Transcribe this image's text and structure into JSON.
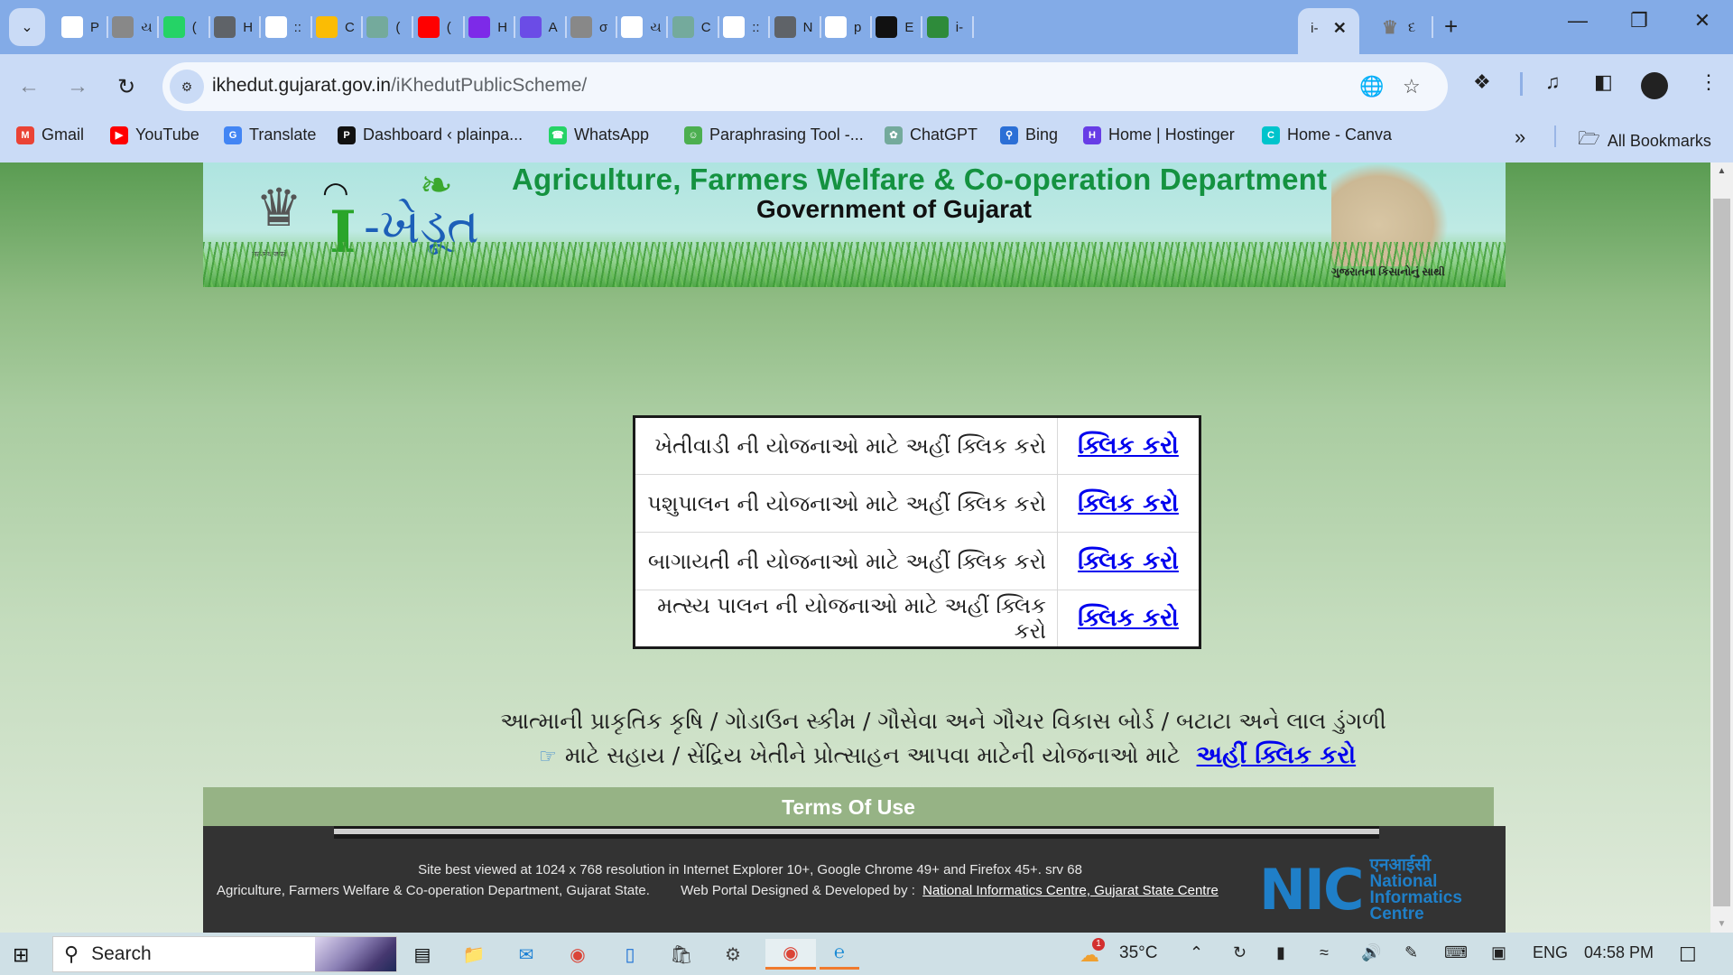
{
  "browser": {
    "tabs": [
      {
        "label": "P",
        "icon": "plainpaper-icon",
        "color": "#ffffff"
      },
      {
        "label": "ય",
        "icon": "emblem-icon",
        "color": "#888888"
      },
      {
        "label": "(",
        "icon": "whatsapp-icon",
        "color": "#25d366"
      },
      {
        "label": "H",
        "icon": "globe-icon",
        "color": "#5f6368"
      },
      {
        "label": "::",
        "icon": "sun-logo-icon",
        "color": "#ffffff"
      },
      {
        "label": "C",
        "icon": "keep-icon",
        "color": "#fbbc04"
      },
      {
        "label": "(",
        "icon": "chatgpt-icon",
        "color": "#74aa9c"
      },
      {
        "label": "(",
        "icon": "youtube-icon",
        "color": "#ff0000"
      },
      {
        "label": "H",
        "icon": "canva-icon",
        "color": "#7d2ae8"
      },
      {
        "label": "A",
        "icon": "app-window-icon",
        "color": "#6b4ce6"
      },
      {
        "label": "σ",
        "icon": "emblem-icon",
        "color": "#888888"
      },
      {
        "label": "ય",
        "icon": "oa-icon",
        "color": "#ffffff"
      },
      {
        "label": "C",
        "icon": "chatgpt-icon",
        "color": "#74aa9c"
      },
      {
        "label": "::",
        "icon": "sun-logo-icon",
        "color": "#ffffff"
      },
      {
        "label": "N",
        "icon": "chrome-icon",
        "color": "#5f6368"
      },
      {
        "label": "p",
        "icon": "google-icon",
        "color": "#ffffff"
      },
      {
        "label": "E",
        "icon": "plain-icon",
        "color": "#111111"
      },
      {
        "label": "i-",
        "icon": "ikhedut-icon",
        "color": "#2e8b3a"
      }
    ],
    "active_tab": {
      "label": "i-",
      "close": "✕"
    },
    "after_tab": {
      "label": "દ",
      "icon": "emblem-icon"
    },
    "new_tab": "+",
    "window": {
      "minimize": "—",
      "restore": "❐",
      "close": "✕"
    },
    "url_host": "ikhedut.gujarat.gov.in",
    "url_path": "/iKhedutPublicScheme/",
    "bookmarks": [
      {
        "label": "Gmail",
        "icon": "gmail-icon",
        "color": "#ea4335",
        "glyph": "M"
      },
      {
        "label": "YouTube",
        "icon": "youtube-icon",
        "color": "#ff0000",
        "glyph": "▶"
      },
      {
        "label": "Translate",
        "icon": "translate-icon",
        "color": "#4285f4",
        "glyph": "G"
      },
      {
        "label": "Dashboard ‹ plainpa...",
        "icon": "plain-icon",
        "color": "#111111",
        "glyph": "P"
      },
      {
        "label": "WhatsApp",
        "icon": "whatsapp-icon",
        "color": "#25d366",
        "glyph": "☎"
      },
      {
        "label": "Paraphrasing Tool -...",
        "icon": "robot-icon",
        "color": "#4caf50",
        "glyph": "☺"
      },
      {
        "label": "ChatGPT",
        "icon": "chatgpt-icon",
        "color": "#74aa9c",
        "glyph": "✿"
      },
      {
        "label": "Bing",
        "icon": "search-icon",
        "color": "#2b6fd6",
        "glyph": "⚲"
      },
      {
        "label": "Home | Hostinger",
        "icon": "hostinger-icon",
        "color": "#673de6",
        "glyph": "H"
      },
      {
        "label": "Home - Canva",
        "icon": "canva-icon",
        "color": "#00c4cc",
        "glyph": "C"
      }
    ],
    "more_bookmarks": "»",
    "all_bookmarks": "All Bookmarks"
  },
  "banner": {
    "department": "Agriculture, Farmers Welfare & Co-operation Department",
    "government": "Government of Gujarat",
    "logo_i": "I",
    "logo_text": "-ખેડૂત",
    "emblem_caption": "सत्यमेव जयते",
    "tagline": "ગુજરાતના કિસાનોનું સાથી"
  },
  "schemes": [
    {
      "text": "ખેતીવાડી ની યોજનાઓ માટે અહીં ક્લિક કરો",
      "link": "ક્લિક કરો"
    },
    {
      "text": "પશુપાલન ની યોજનાઓ માટે અહીં ક્લિક કરો",
      "link": "ક્લિક કરો"
    },
    {
      "text": "બાગાયતી ની યોજનાઓ માટે અહીં ક્લિક કરો",
      "link": "ક્લિક કરો"
    },
    {
      "text": "મત્સ્ય પાલન ની યોજનાઓ માટે અહીં ક્લિક કરો",
      "link": "ક્લિક કરો"
    }
  ],
  "extra": {
    "line1": "આત્માની પ્રાકૃતિક કૃષિ / ગોડાઉન સ્કીમ / ગૌસેવા અને ગૌચર વિકાસ બોર્ડ / બટાટા અને લાલ ડુંગળી",
    "line2": "માટે સહાય / સેંદ્રિય ખેતીને પ્રોત્સાહન આપવા માટેની યોજનાઓ માટે",
    "link": "અહીં ક્લિક કરો"
  },
  "footer": {
    "terms": "Terms Of Use",
    "line1": "Site best viewed at 1024 x 768 resolution in Internet Explorer 10+, Google Chrome 49+ and Firefox 45+. srv 68",
    "line2_left": "Agriculture, Farmers Welfare & Co-operation Department, Gujarat State.",
    "line2_mid": "Web Portal Designed & Developed by :",
    "line2_link": "National Informatics Centre, Gujarat State Centre",
    "nic_logo": "NIC",
    "nic_hindi": "एनआईसी",
    "nic_name": [
      "National",
      "Informatics",
      "Centre"
    ]
  },
  "taskbar": {
    "search_label": "Search",
    "weather_temp": "35°C",
    "weather_badge": "1",
    "language": "ENG",
    "time": "04:58 PM"
  }
}
